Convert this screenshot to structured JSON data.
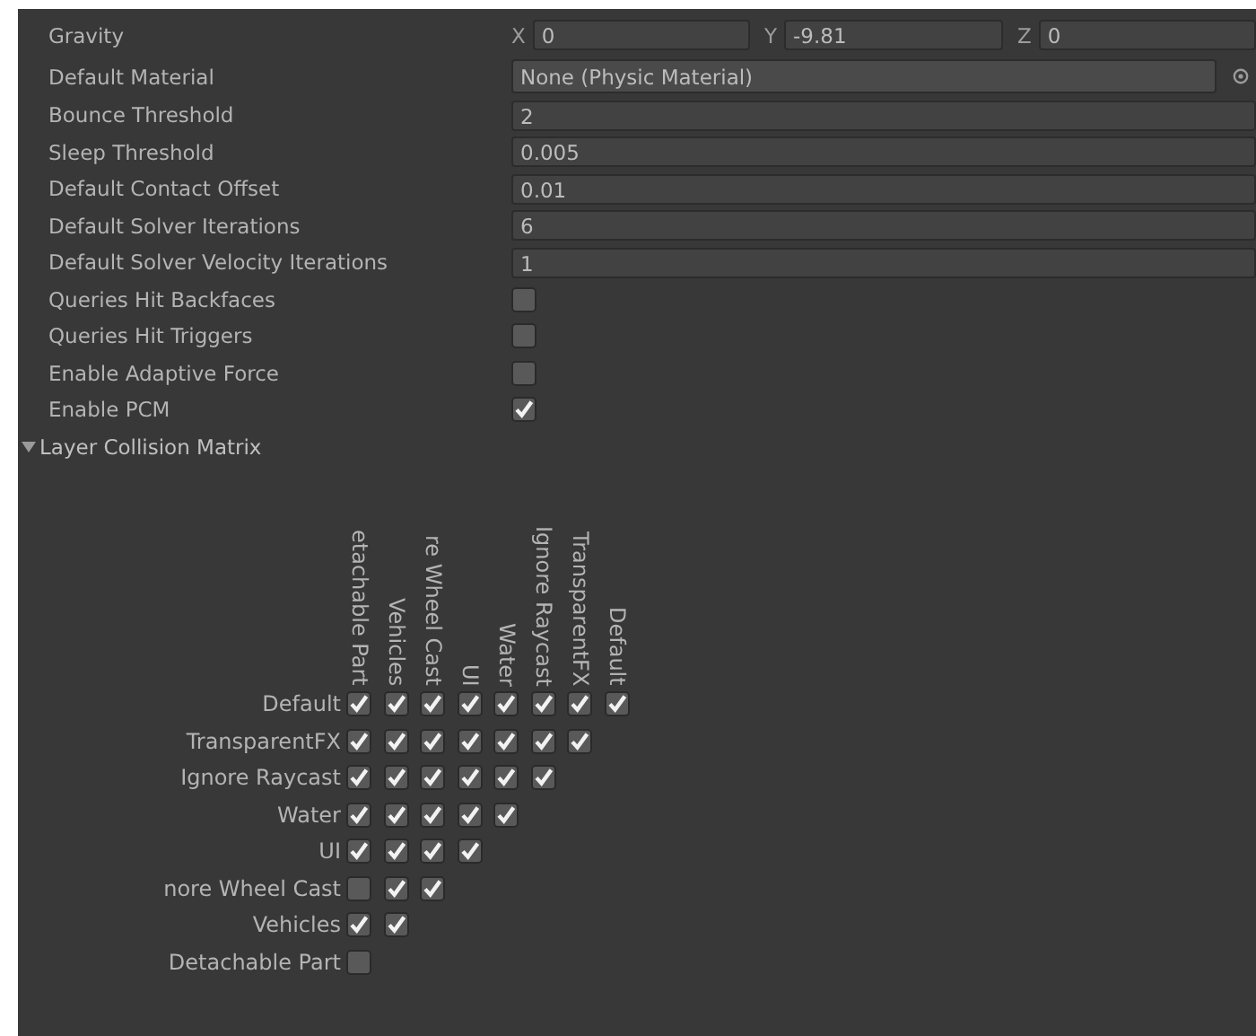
{
  "settings": [
    {
      "kind": "vector",
      "label": "Gravity",
      "parts": [
        {
          "axis": "X",
          "value": "0"
        },
        {
          "axis": "Y",
          "value": "-9.81"
        },
        {
          "axis": "Z",
          "value": "0"
        }
      ]
    },
    {
      "kind": "object",
      "label": "Default Material",
      "value": "None (Physic Material)"
    },
    {
      "kind": "text",
      "label": "Bounce Threshold",
      "value": "2"
    },
    {
      "kind": "text",
      "label": "Sleep Threshold",
      "value": "0.005"
    },
    {
      "kind": "text",
      "label": "Default Contact Offset",
      "value": "0.01"
    },
    {
      "kind": "text",
      "label": "Default Solver Iterations",
      "value": "6"
    },
    {
      "kind": "text",
      "label": "Default Solver Velocity Iterations",
      "value": "1"
    },
    {
      "kind": "checkbox",
      "label": "Queries Hit Backfaces",
      "checked": false
    },
    {
      "kind": "checkbox",
      "label": "Queries Hit Triggers",
      "checked": false
    },
    {
      "kind": "checkbox",
      "label": "Enable Adaptive Force",
      "checked": false
    },
    {
      "kind": "checkbox",
      "label": "Enable PCM",
      "checked": true
    }
  ],
  "matrix": {
    "title": "Layer Collision Matrix",
    "expanded": true,
    "columns": [
      "etachable Part",
      "Vehicles",
      "re Wheel Cast",
      "UI",
      "Water",
      "Ignore Raycast",
      "TransparentFX",
      "Default"
    ],
    "rows": [
      {
        "label": "Default",
        "cells": [
          {
            "checked": true
          },
          {
            "checked": true
          },
          {
            "checked": true
          },
          {
            "checked": true
          },
          {
            "checked": true
          },
          {
            "checked": true
          },
          {
            "checked": true
          },
          {
            "checked": true
          }
        ]
      },
      {
        "label": "TransparentFX",
        "cells": [
          {
            "checked": true
          },
          {
            "checked": true
          },
          {
            "checked": true
          },
          {
            "checked": true
          },
          {
            "checked": true
          },
          {
            "checked": true
          },
          {
            "checked": true
          }
        ]
      },
      {
        "label": "Ignore Raycast",
        "cells": [
          {
            "checked": true
          },
          {
            "checked": true
          },
          {
            "checked": true
          },
          {
            "checked": true
          },
          {
            "checked": true
          },
          {
            "checked": true
          }
        ]
      },
      {
        "label": "Water",
        "cells": [
          {
            "checked": true
          },
          {
            "checked": true
          },
          {
            "checked": true
          },
          {
            "checked": true
          },
          {
            "checked": true
          }
        ]
      },
      {
        "label": "UI",
        "cells": [
          {
            "checked": true
          },
          {
            "checked": true
          },
          {
            "checked": true
          },
          {
            "checked": true
          }
        ]
      },
      {
        "label": "nore Wheel Cast",
        "cells": [
          {
            "checked": false
          },
          {
            "checked": true
          },
          {
            "checked": true
          }
        ]
      },
      {
        "label": "Vehicles",
        "cells": [
          {
            "checked": true
          },
          {
            "checked": true
          }
        ]
      },
      {
        "label": "Detachable Part",
        "cells": [
          {
            "checked": false
          }
        ]
      }
    ]
  }
}
